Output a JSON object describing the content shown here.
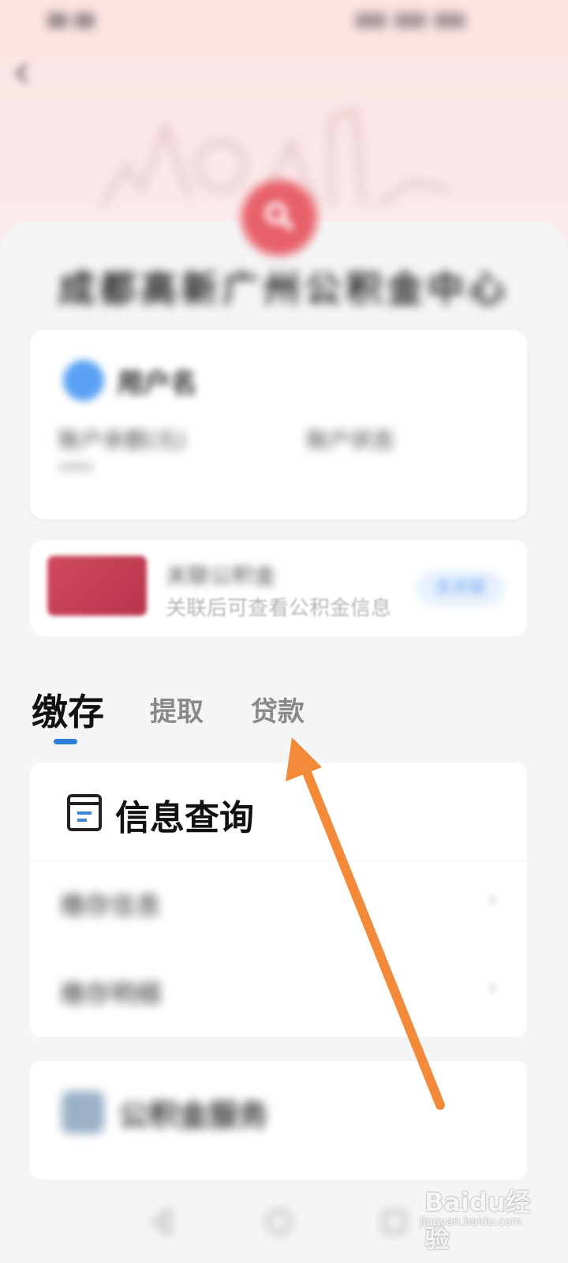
{
  "center_title": "成都高新广州公积金中心",
  "account": {
    "user_name": "用户名",
    "label_1": "账户余额(元)",
    "value_1": "****",
    "label_2": "账户状态"
  },
  "bind": {
    "title": "关联公积金",
    "description": "关联后可查看公积金信息",
    "button": "去关联"
  },
  "tabs": [
    {
      "label": "缴存",
      "active": true
    },
    {
      "label": "提取",
      "active": false
    },
    {
      "label": "贷款",
      "active": false
    }
  ],
  "info_query": {
    "title": "信息查询",
    "rows": [
      "缴存信息",
      "缴存明细"
    ]
  },
  "service": {
    "title": "公积金服务"
  },
  "watermark": {
    "brand": "Baidu经验",
    "domain": "jingyan.baidu.com"
  },
  "colors": {
    "accent": "#2d7fd5",
    "annotation_arrow": "#f28a3a",
    "logo": "#e8616a"
  }
}
